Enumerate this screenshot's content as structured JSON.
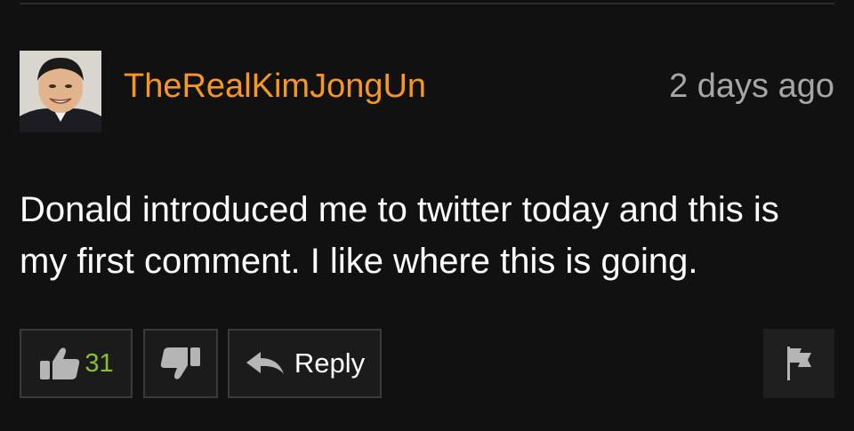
{
  "comment": {
    "username": "TheRealKimJongUn",
    "timestamp": "2 days ago",
    "text": "Donald introduced me to twitter today and this is my first comment. I like where this is going."
  },
  "actions": {
    "like_count": "31",
    "reply_label": "Reply"
  },
  "colors": {
    "background": "#111111",
    "username": "#f7971d",
    "timestamp": "#a6a6a6",
    "text": "#ffffff",
    "like_count": "#8bbf2f",
    "button_border": "#3a3a3a",
    "icon": "#b5b5b5"
  },
  "icons": [
    "thumbs-up-icon",
    "thumbs-down-icon",
    "reply-arrow-icon",
    "flag-icon"
  ]
}
